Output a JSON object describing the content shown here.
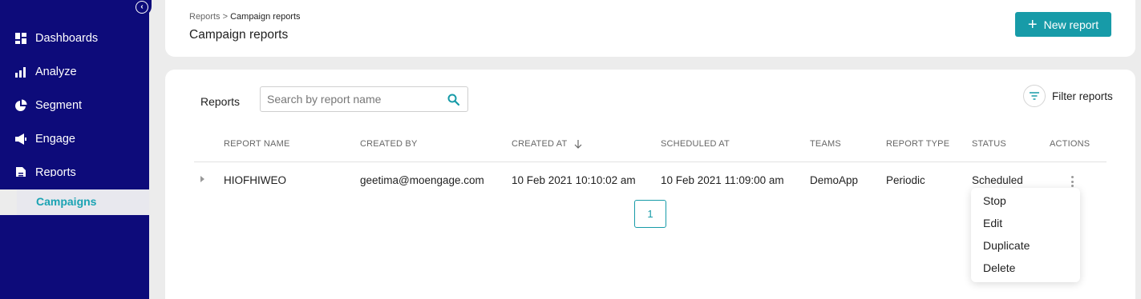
{
  "sidebar": {
    "items": [
      {
        "label": "Dashboards",
        "icon": "dashboard-icon"
      },
      {
        "label": "Analyze",
        "icon": "bar-chart-icon"
      },
      {
        "label": "Segment",
        "icon": "pie-chart-icon"
      },
      {
        "label": "Engage",
        "icon": "megaphone-icon"
      },
      {
        "label": "Reports",
        "icon": "document-icon"
      }
    ],
    "sub_item": "Campaigns",
    "collapse_icon": "chevron-left-icon"
  },
  "header": {
    "breadcrumb_root": "Reports",
    "breadcrumb_sep": ">",
    "breadcrumb_current": "Campaign reports",
    "title": "Campaign reports",
    "new_report_label": "New report"
  },
  "main": {
    "reports_label": "Reports",
    "search_placeholder": "Search by report name",
    "filter_label": "Filter reports",
    "columns": [
      "REPORT NAME",
      "CREATED BY",
      "CREATED AT",
      "SCHEDULED AT",
      "TEAMS",
      "REPORT TYPE",
      "STATUS",
      "ACTIONS"
    ],
    "rows": [
      {
        "name": "HIOFHIWEO",
        "created_by": "geetima@moengage.com",
        "created_at": "10 Feb 2021 10:10:02 am",
        "scheduled_at": "10 Feb 2021 11:09:00 am",
        "teams": "DemoApp",
        "report_type": "Periodic",
        "status": "Scheduled"
      }
    ],
    "page": "1",
    "actions_menu": [
      "Stop",
      "Edit",
      "Duplicate",
      "Delete"
    ]
  },
  "colors": {
    "sidebar_bg": "#0d0b7a",
    "accent": "#179ba8",
    "page_bg": "#ececec"
  }
}
